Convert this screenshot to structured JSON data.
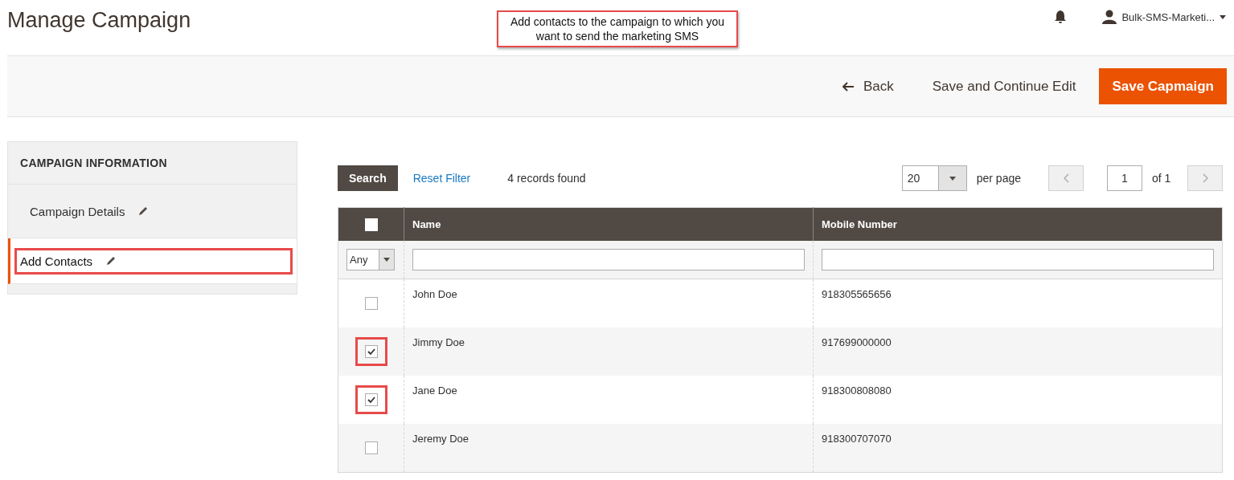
{
  "page_title": "Manage Campaign",
  "callout": {
    "text": "Add contacts to the campaign to which you want to send the marketing SMS"
  },
  "user_menu": {
    "label": "Bulk-SMS-Marketi..."
  },
  "actions": {
    "back": "Back",
    "save_continue": "Save and Continue Edit",
    "save": "Save Capmaign"
  },
  "sidebar": {
    "title": "CAMPAIGN INFORMATION",
    "items": [
      {
        "label": "Campaign Details",
        "selected": false,
        "highlighted": false
      },
      {
        "label": "Add Contacts",
        "selected": true,
        "highlighted": true
      }
    ]
  },
  "toolbar": {
    "search": "Search",
    "reset": "Reset Filter",
    "records": "4 records found",
    "per_page_value": "20",
    "per_page": "per page",
    "page": "1",
    "of": "of 1"
  },
  "table": {
    "select_all": {
      "checked": false
    },
    "columns": [
      "Name",
      "Mobile Number"
    ],
    "filter": {
      "select": "Any"
    },
    "rows": [
      {
        "checked": false,
        "highlighted": false,
        "name": "John Doe",
        "mobile": "918305565656"
      },
      {
        "checked": true,
        "highlighted": true,
        "name": "Jimmy Doe",
        "mobile": "917699000000"
      },
      {
        "checked": true,
        "highlighted": true,
        "name": "Jane Doe",
        "mobile": "918300808080"
      },
      {
        "checked": false,
        "highlighted": false,
        "name": "Jeremy Doe",
        "mobile": "918300707070"
      }
    ]
  }
}
